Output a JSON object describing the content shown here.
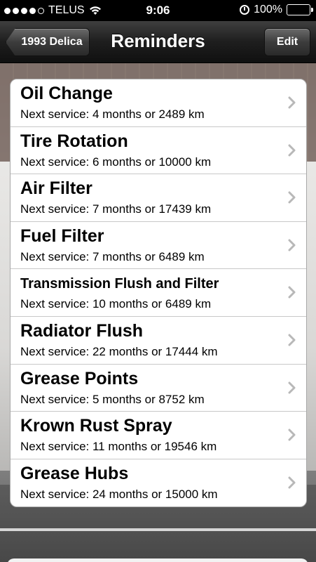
{
  "status_bar": {
    "carrier": "TELUS",
    "signal_bars_filled": 4,
    "signal_bars_total": 5,
    "time": "9:06",
    "battery_percent": "100%"
  },
  "nav": {
    "back_label": "1993 Delica",
    "title": "Reminders",
    "edit_label": "Edit"
  },
  "reminders": [
    {
      "name": "Oil Change",
      "detail": "Next service: 4 months or 2489 km"
    },
    {
      "name": "Tire Rotation",
      "detail": "Next service: 6 months or 10000 km"
    },
    {
      "name": "Air Filter",
      "detail": "Next service: 7 months or 17439 km"
    },
    {
      "name": "Fuel Filter",
      "detail": "Next service: 7 months or 6489 km"
    },
    {
      "name": "Transmission Flush and Filter",
      "detail": "Next service: 10 months or 6489 km"
    },
    {
      "name": "Radiator Flush",
      "detail": "Next service: 22 months or 17444 km"
    },
    {
      "name": "Grease Points",
      "detail": "Next service: 5 months or 8752 km"
    },
    {
      "name": "Krown Rust Spray",
      "detail": "Next service: 11 months or 19546 km"
    },
    {
      "name": "Grease Hubs",
      "detail": "Next service: 24 months or 15000 km"
    }
  ],
  "icons": {
    "wifi": "wifi-icon",
    "alarm": "alarm-icon",
    "battery": "battery-icon",
    "disclosure": "chevron-right-icon"
  }
}
